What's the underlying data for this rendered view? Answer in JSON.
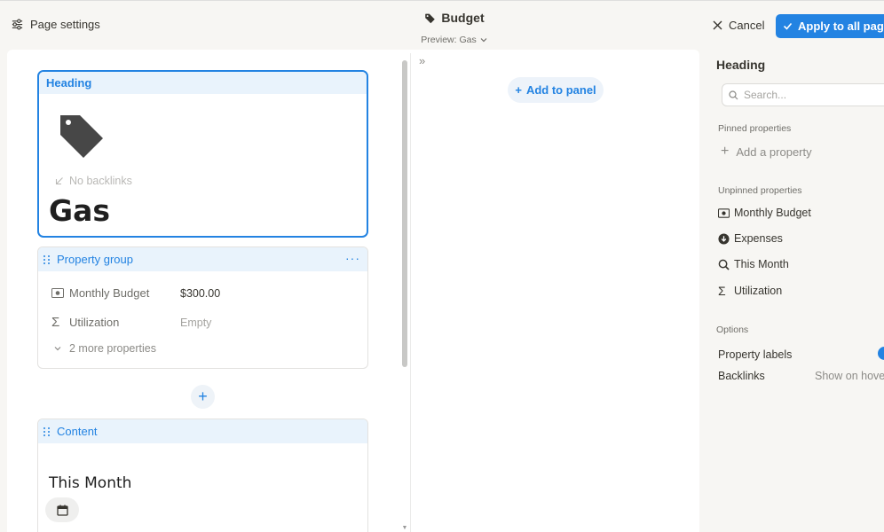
{
  "topbar": {
    "page_settings_label": "Page settings",
    "title": "Budget",
    "preview_label": "Preview: Gas",
    "cancel_label": "Cancel",
    "apply_label": "Apply to all pages",
    "accent_color": "#2383e2"
  },
  "heading_card": {
    "label": "Heading",
    "page_icon": "tag-icon",
    "backlinks_label": "No backlinks",
    "page_title": "Gas"
  },
  "property_group": {
    "label": "Property group",
    "more_label": "···",
    "rows": [
      {
        "icon": "money-icon",
        "name": "Monthly Budget",
        "value": "$300.00"
      },
      {
        "icon": "sigma-icon",
        "name": "Utilization",
        "value": "Empty"
      }
    ],
    "more_properties_label": "2 more properties"
  },
  "add_block_label": "+",
  "content_card": {
    "label": "Content",
    "section_title": "This Month",
    "chip_icon": "calendar-icon"
  },
  "middle": {
    "collapse_label": "»",
    "add_panel_label": "Add to panel"
  },
  "right_panel": {
    "title": "Heading",
    "search_placeholder": "Search...",
    "pinned_label": "Pinned properties",
    "add_property_label": "Add a property",
    "unpinned_label": "Unpinned properties",
    "unpinned_items": [
      {
        "icon": "money-icon",
        "label": "Monthly Budget"
      },
      {
        "icon": "arrow-down-circle-icon",
        "label": "Expenses"
      },
      {
        "icon": "search-icon",
        "label": "This Month"
      },
      {
        "icon": "sigma-icon",
        "label": "Utilization"
      }
    ],
    "options_label": "Options",
    "property_labels_label": "Property labels",
    "property_labels_on": true,
    "backlinks_label": "Backlinks",
    "backlinks_value": "Show on hover"
  }
}
